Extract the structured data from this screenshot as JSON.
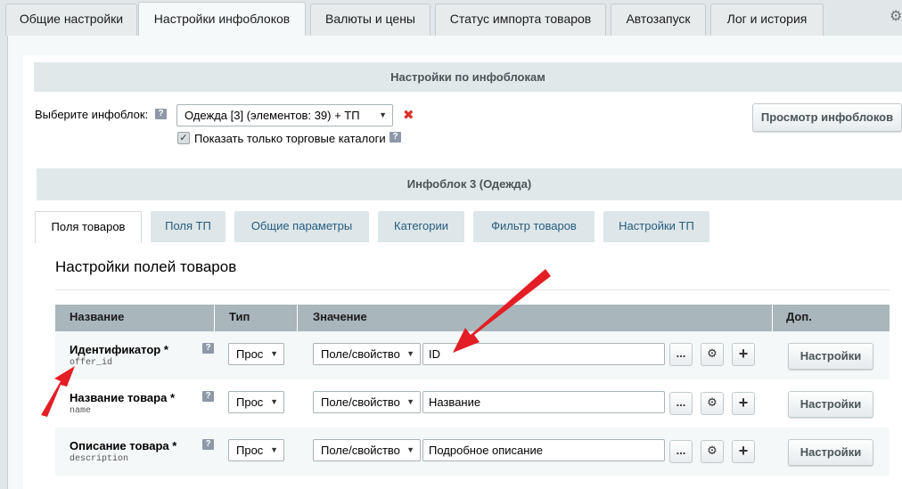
{
  "top_tabs": [
    {
      "label": "Общие настройки"
    },
    {
      "label": "Настройки инфоблоков"
    },
    {
      "label": "Валюты и цены"
    },
    {
      "label": "Статус импорта товаров"
    },
    {
      "label": "Автозапуск"
    },
    {
      "label": "Лог и история"
    }
  ],
  "section_title": "Настройки по инфоблокам",
  "select_label": "Выберите инфоблок:",
  "iblock_select": "Одежда [3] (элементов: 39) + ТП",
  "checkbox_label": "Показать только торговые каталоги",
  "checkbox_checked": true,
  "view_button": "Просмотр инфоблоков",
  "iblock_title": "Инфоблок 3 (Одежда)",
  "inner_tabs": [
    {
      "label": "Поля товаров"
    },
    {
      "label": "Поля ТП"
    },
    {
      "label": "Общие параметры"
    },
    {
      "label": "Категории"
    },
    {
      "label": "Фильтр товаров"
    },
    {
      "label": "Настройки ТП"
    }
  ],
  "content_heading": "Настройки полей товаров",
  "table": {
    "headers": [
      "Название",
      "Тип",
      "Значение",
      "Доп."
    ],
    "rows": [
      {
        "name": "Идентификатор",
        "required": "*",
        "code": "offer_id",
        "type": "Прос",
        "source": "Поле/свойство",
        "value": "ID",
        "dots": "...",
        "plus": "+",
        "settings": "Настройки"
      },
      {
        "name": "Название товара",
        "required": "*",
        "code": "name",
        "type": "Прос",
        "source": "Поле/свойство",
        "value": "Название",
        "dots": "...",
        "plus": "+",
        "settings": "Настройки"
      },
      {
        "name": "Описание товара",
        "required": "*",
        "code": "description",
        "type": "Прос",
        "source": "Поле/свойство",
        "value": "Подробное описание",
        "dots": "...",
        "plus": "+",
        "settings": "Настройки"
      }
    ]
  },
  "help_mark": "?",
  "accent_color": "#e31e24"
}
